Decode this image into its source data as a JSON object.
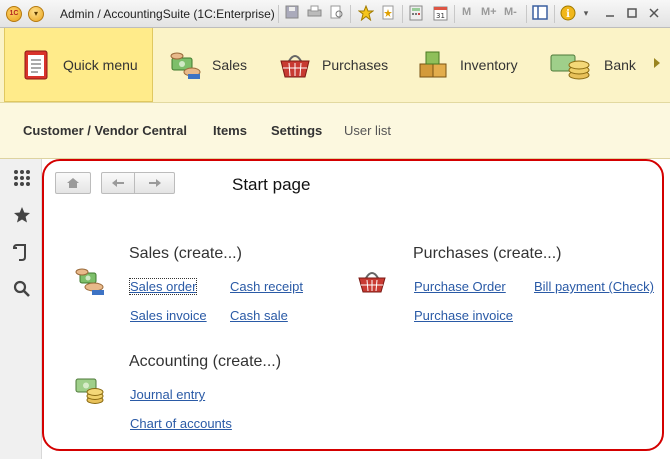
{
  "titlebar": {
    "title": "Admin / AccountingSuite   (1C:Enterprise)",
    "logo_text": "1С",
    "memory_buttons": [
      "M",
      "M+",
      "M-"
    ]
  },
  "sections": [
    {
      "label": "Quick menu",
      "icon": "quick-menu-icon",
      "active": true
    },
    {
      "label": "Sales",
      "icon": "sales-icon",
      "active": false
    },
    {
      "label": "Purchases",
      "icon": "purchases-basket-icon",
      "active": false
    },
    {
      "label": "Inventory",
      "icon": "inventory-boxes-icon",
      "active": false
    },
    {
      "label": "Bank",
      "icon": "bank-coins-icon",
      "active": false
    }
  ],
  "commands": [
    {
      "label": "Customer / Vendor Central"
    },
    {
      "label": "Items"
    },
    {
      "label": "Settings"
    },
    {
      "label": "User list"
    }
  ],
  "main": {
    "page_title": "Start page",
    "groups": [
      {
        "title": "Sales (create...)",
        "links": [
          "Sales order",
          "Cash receipt",
          "Sales invoice",
          "Cash sale"
        ]
      },
      {
        "title": "Purchases (create...)",
        "links": [
          "Purchase Order",
          "Bill payment (Check)",
          "Purchase invoice"
        ]
      },
      {
        "title": "Accounting (create...)",
        "links": [
          "Journal entry",
          "Chart of accounts"
        ]
      }
    ]
  },
  "colors": {
    "accent_frame": "#d40000",
    "section_bg": "#fbf3c7",
    "link": "#2a5aa6"
  }
}
